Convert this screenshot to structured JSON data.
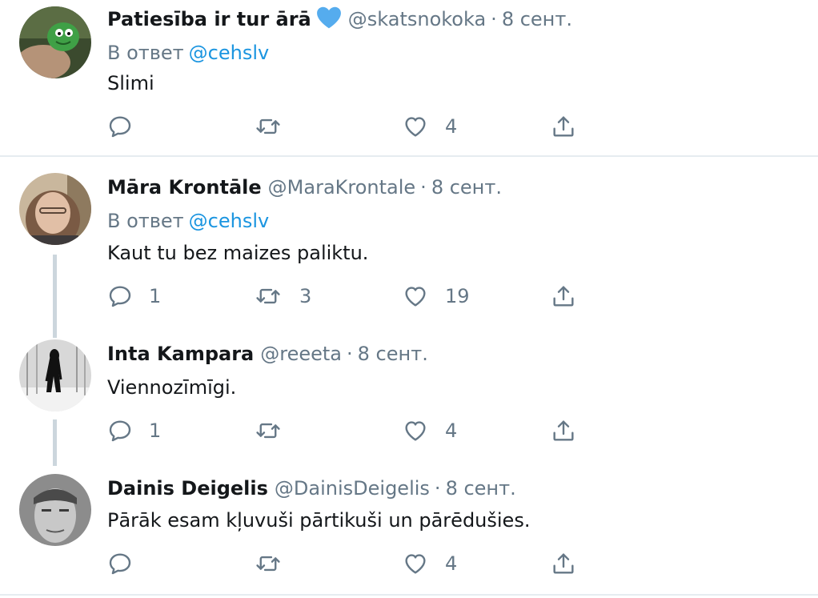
{
  "colors": {
    "text": "#14171a",
    "secondary": "#657786",
    "link": "#1b95e0",
    "divider": "#e6ecf0",
    "thread_line": "#ccd6dd",
    "heart_badge": "#55acee"
  },
  "icons": {
    "reply": "reply-icon",
    "retweet": "retweet-icon",
    "like": "heart-icon",
    "share": "share-icon",
    "badge": "blue-heart-icon"
  },
  "tweets": [
    {
      "name": "Patiesība ir tur ārā",
      "handle": "@skatsnokoka",
      "separator": "·",
      "date": "8 сент.",
      "reply_prefix": "В ответ",
      "reply_mention": "@cehslv",
      "text": "Slimi",
      "replies": "",
      "retweets": "",
      "likes": "4"
    },
    {
      "name": "Māra Krontāle",
      "handle": "@MaraKrontale",
      "separator": "·",
      "date": "8 сент.",
      "reply_prefix": "В ответ",
      "reply_mention": "@cehslv",
      "text": "Kaut tu bez maizes paliktu.",
      "replies": "1",
      "retweets": "3",
      "likes": "19"
    },
    {
      "name": "Inta Kampara",
      "handle": "@reeeta",
      "separator": "·",
      "date": "8 сент.",
      "text": "Viennozīmīgi.",
      "replies": "1",
      "retweets": "",
      "likes": "4"
    },
    {
      "name": "Dainis Deigelis",
      "handle": "@DainisDeigelis",
      "separator": "·",
      "date": "8 сент.",
      "text": "Pārāk esam kļuvuši pārtikuši un pārēdušies.",
      "replies": "",
      "retweets": "",
      "likes": "4"
    }
  ]
}
